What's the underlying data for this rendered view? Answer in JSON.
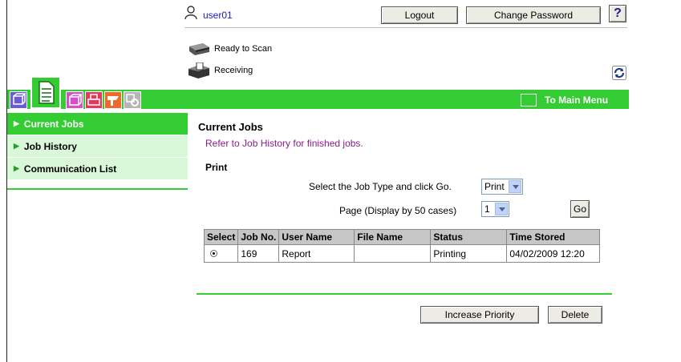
{
  "header": {
    "username": "user01",
    "logout_label": "Logout",
    "change_password_label": "Change Password",
    "help_label": "?"
  },
  "status": {
    "scan": "Ready to Scan",
    "receive": "Receiving"
  },
  "menu": {
    "to_main_menu": "To Main Menu"
  },
  "sidebar": {
    "items": [
      {
        "label": "Current Jobs",
        "active": true
      },
      {
        "label": "Job History",
        "active": false
      },
      {
        "label": "Communication List",
        "active": false
      }
    ]
  },
  "main": {
    "title": "Current Jobs",
    "note": "Refer to Job History for finished jobs.",
    "section": "Print",
    "job_type_label": "Select the Job Type and click Go.",
    "job_type_value": "Print",
    "page_label": "Page (Display by 50 cases)",
    "page_value": "1",
    "go_label": "Go",
    "table": {
      "headers": [
        "Select",
        "Job No.",
        "User Name",
        "File Name",
        "Status",
        "Time Stored"
      ],
      "rows": [
        {
          "job_no": "169",
          "user": "Report",
          "file": "",
          "status": "Printing",
          "time": "04/02/2009 12:20"
        }
      ]
    },
    "increase_priority_label": "Increase Priority",
    "delete_label": "Delete"
  },
  "colors": {
    "accent_green": "#33cc33",
    "sidebar_light": "#d9f7d9",
    "note_purple": "#8b1a8b",
    "user_blue": "#1a1ab8"
  }
}
